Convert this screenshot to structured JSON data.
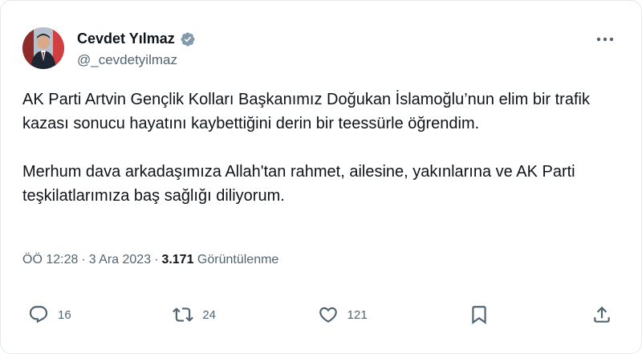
{
  "author": {
    "name": "Cevdet Yılmaz",
    "handle": "@_cevdetyilmaz",
    "verified": true,
    "badge_color": "#829aab"
  },
  "menu_icon": "more-horizontal-icon",
  "tweet": {
    "paragraphs": [
      "AK Parti Artvin Gençlik Kolları Başkanımız Doğukan İslamoğlu’nun elim bir trafik kazası sonucu hayatını kaybettiğini derin bir teessürle öğrendim.",
      "Merhum dava arkadaşımıza Allah'tan rahmet, ailesine, yakınlarına ve AK Parti teşkilatlarımıza baş sağlığı diliyorum."
    ]
  },
  "meta": {
    "time": "ÖÖ 12:28",
    "separator": "·",
    "date": "3 Ara 2023",
    "views_count": "3.171",
    "views_label": " Görüntülenme"
  },
  "actions": {
    "replies": {
      "icon": "reply-icon",
      "count": "16"
    },
    "reposts": {
      "icon": "repost-icon",
      "count": "24"
    },
    "likes": {
      "icon": "like-icon",
      "count": "121"
    },
    "bookmark": {
      "icon": "bookmark-icon"
    },
    "share": {
      "icon": "share-icon"
    }
  },
  "colors": {
    "text": "#0f1419",
    "secondary": "#536471",
    "border": "#e6e9ec"
  }
}
